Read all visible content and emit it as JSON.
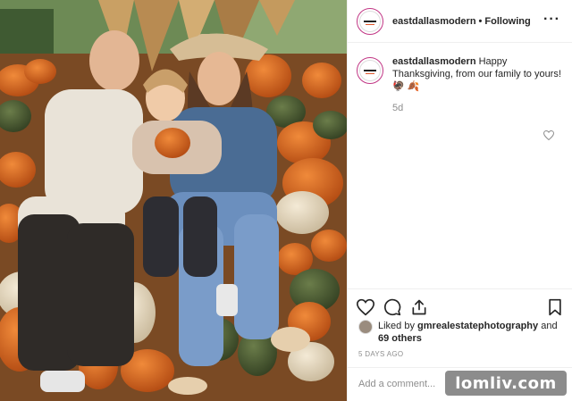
{
  "post": {
    "username": "eastdallasmodern",
    "separator": "•",
    "follow_status": "Following",
    "more_icon": "more-horizontal-icon",
    "caption": {
      "username": "eastdallasmodern",
      "text": "Happy Thanksgiving, from our family to yours! 🦃 🍂",
      "time": "5d"
    },
    "icons": {
      "like": "heart-icon",
      "comment": "comment-icon",
      "share": "share-icon",
      "save": "bookmark-icon",
      "comment_like": "heart-small-icon"
    },
    "likes": {
      "prefix": "Liked by",
      "user": "gmrealestatephotography",
      "joiner": "and",
      "others": "69 others"
    },
    "date": "5 DAYS AGO",
    "add_comment_placeholder": "Add a comment..."
  },
  "watermark": "lomliv.com",
  "colors": {
    "story_ring": "#c13584",
    "muted_text": "#8e8e8e",
    "border": "#efefef"
  }
}
